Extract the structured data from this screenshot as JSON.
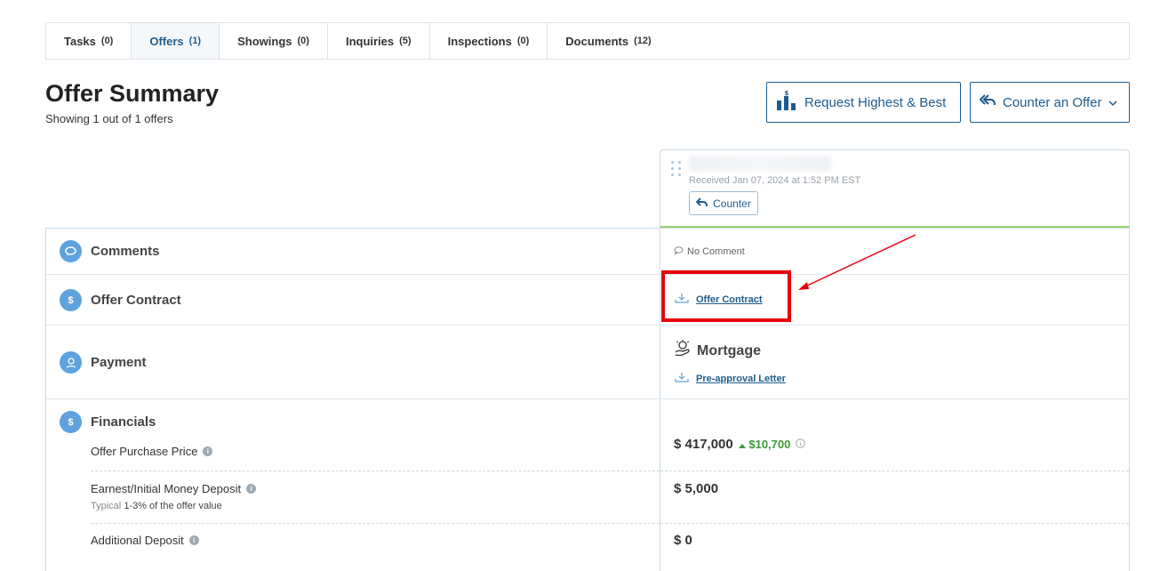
{
  "tabs": [
    {
      "label": "Tasks",
      "count": "(0)"
    },
    {
      "label": "Offers",
      "count": "(1)"
    },
    {
      "label": "Showings",
      "count": "(0)"
    },
    {
      "label": "Inquiries",
      "count": "(5)"
    },
    {
      "label": "Inspections",
      "count": "(0)"
    },
    {
      "label": "Documents",
      "count": "(12)"
    }
  ],
  "header": {
    "title": "Offer Summary",
    "subtitle": "Showing 1 out of 1 offers",
    "request_button": "Request Highest & Best",
    "counter_button": "Counter an Offer"
  },
  "offer": {
    "received": "Received Jan 07, 2024 at 1:52 PM EST",
    "counter_label": "Counter"
  },
  "rows": {
    "comments": {
      "label": "Comments",
      "value": "No Comment"
    },
    "contract": {
      "label": "Offer Contract",
      "link": "Offer Contract"
    },
    "payment": {
      "label": "Payment",
      "method": "Mortgage",
      "link": "Pre-approval Letter"
    },
    "financials": {
      "label": "Financials",
      "purchase_price_label": "Offer Purchase Price",
      "purchase_price": "$ 417,000",
      "purchase_delta": "$10,700",
      "earnest_label": "Earnest/Initial Money Deposit",
      "earnest_typical_prefix": "Typical",
      "earnest_typical": "1-3% of the offer value",
      "earnest_value": "$ 5,000",
      "additional_label": "Additional Deposit",
      "additional_value": "$ 0"
    }
  },
  "colors": {
    "accent": "#1f5c8c",
    "icon_blue": "#5fa2dd",
    "green_bar": "#9bd26b",
    "highlight_red": "#e8000b",
    "delta_green": "#3a9a3a"
  }
}
